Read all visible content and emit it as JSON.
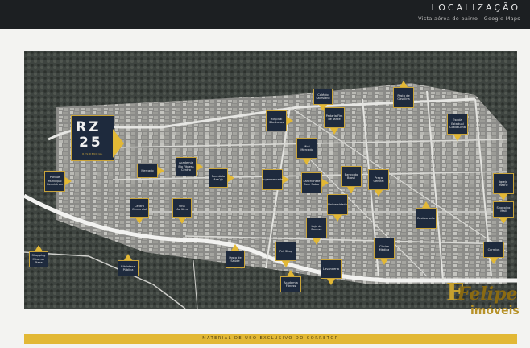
{
  "header": {
    "title": "LOCALIZAÇÃO",
    "subtitle": "Vista aérea do bairro - Google Maps"
  },
  "map": {
    "pins": [
      {
        "label": "Shopping Miramar Plaza",
        "icon": "map-pin"
      },
      {
        "label": "Parque Municipal Benzidinas",
        "icon": "map-pin"
      },
      {
        "label": "Mercado",
        "icon": "map-pin"
      },
      {
        "label": "Academia Bio Fitness Centro",
        "icon": "map-pin"
      },
      {
        "label": "Farmácia Araújo",
        "icon": "map-pin"
      },
      {
        "label": "Hospital São Lucas",
        "icon": "map-pin"
      },
      {
        "label": "Colégio Salesiano",
        "icon": "map-pin"
      },
      {
        "label": "Padaria Fim de Tarde",
        "icon": "map-pin"
      },
      {
        "label": "Posto de Gasolina",
        "icon": "map-pin"
      },
      {
        "label": "Escola Estadual Costa Lima",
        "icon": "map-pin"
      },
      {
        "label": "Mini Mercado",
        "icon": "map-pin"
      },
      {
        "label": "Supermercado",
        "icon": "map-pin"
      },
      {
        "label": "Lanchonete Bom Sabor",
        "icon": "map-pin"
      },
      {
        "label": "Banco do Brasil",
        "icon": "map-pin"
      },
      {
        "label": "Praça Central",
        "icon": "map-pin"
      },
      {
        "label": "Igreja Matriz",
        "icon": "map-pin"
      },
      {
        "label": "Shopping Mall",
        "icon": "map-pin"
      },
      {
        "label": "Correios",
        "icon": "map-pin"
      },
      {
        "label": "Restaurante",
        "icon": "map-pin"
      },
      {
        "label": "Clínica Médica",
        "icon": "map-pin"
      },
      {
        "label": "Universidade",
        "icon": "map-pin"
      },
      {
        "label": "Loja de Roupas",
        "icon": "map-pin"
      },
      {
        "label": "Pet Shop",
        "icon": "map-pin"
      },
      {
        "label": "Lavanderia",
        "icon": "map-pin"
      },
      {
        "label": "Academia Fitness",
        "icon": "map-pin"
      },
      {
        "label": "Posto de Saúde",
        "icon": "map-pin"
      },
      {
        "label": "Biblioteca Pública",
        "icon": "map-pin"
      },
      {
        "label": "Centro Comercial",
        "icon": "map-pin"
      },
      {
        "label": "Orla Marítima",
        "icon": "map-pin"
      }
    ],
    "marker": {
      "line1": "RZ",
      "line2": "25",
      "tagline": "RESIDENCIAL"
    }
  },
  "footer": {
    "text": "MATERIAL DE USO EXCLUSIVO DO CORRETOR"
  },
  "logo": {
    "name": "Felipe",
    "sub": "imóveis",
    "initial": "F"
  },
  "colors": {
    "accent": "#e2b835",
    "navy": "#1e2a3d",
    "header": "#1c1f22"
  }
}
